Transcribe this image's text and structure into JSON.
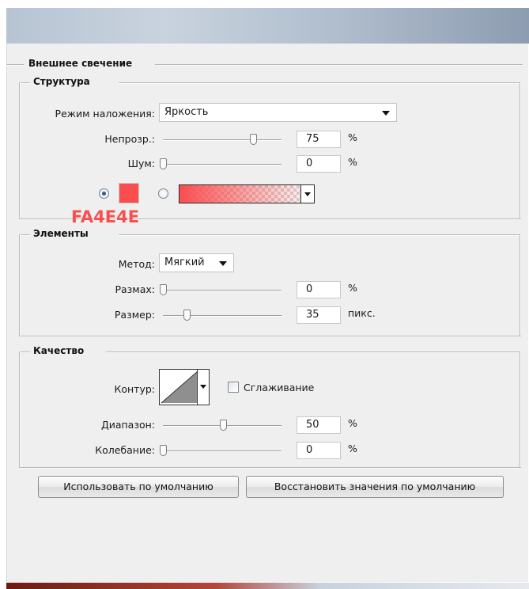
{
  "dialog": {
    "title": "Внешнее свечение"
  },
  "structure": {
    "title": "Структура",
    "blend_mode_label": "Режим наложения:",
    "blend_mode_value": "Яркость",
    "opacity_label": "Непрозр.:",
    "opacity_value": "75",
    "opacity_unit": "%",
    "opacity_slider_fraction": 0.75,
    "noise_label": "Шум:",
    "noise_value": "0",
    "noise_unit": "%",
    "noise_slider_fraction": 0.0,
    "color_hex_label": "FA4E4E",
    "glow_color": "#FA4E4E",
    "solid_color_selected": true,
    "gradient_selected": false
  },
  "elements": {
    "title": "Элементы",
    "method_label": "Метод:",
    "method_value": "Мягкий",
    "spread_label": "Размах:",
    "spread_value": "0",
    "spread_unit": "%",
    "spread_slider_fraction": 0.0,
    "size_label": "Размер:",
    "size_value": "35",
    "size_unit": "пикс.",
    "size_slider_fraction": 0.2
  },
  "quality": {
    "title": "Качество",
    "contour_label": "Контур:",
    "antialias_label": "Сглаживание",
    "antialias_checked": false,
    "range_label": "Диапазон:",
    "range_value": "50",
    "range_unit": "%",
    "range_slider_fraction": 0.5,
    "jitter_label": "Колебание:",
    "jitter_value": "0",
    "jitter_unit": "%",
    "jitter_slider_fraction": 0.0
  },
  "buttons": {
    "make_default": "Использовать по умолчанию",
    "reset_default": "Восстановить значения по умолчанию"
  }
}
